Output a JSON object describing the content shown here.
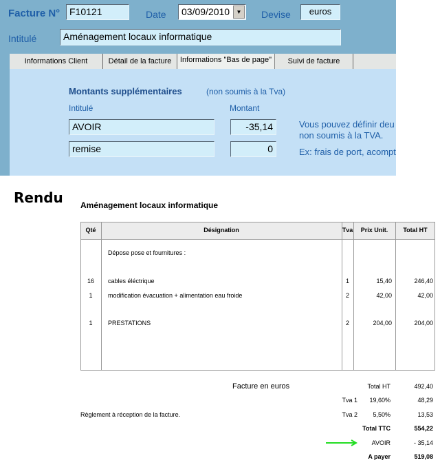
{
  "form": {
    "invoice_label": "Facture N°",
    "invoice_number": "F10121",
    "date_label": "Date",
    "date_value": "03/09/2010",
    "currency_label": "Devise",
    "currency_value": "euros",
    "title_label": "Intitulé",
    "title_value": "Aménagement locaux informatique"
  },
  "tabs": [
    {
      "label": "Informations Client"
    },
    {
      "label": "Détail de la facture"
    },
    {
      "label": "Informations \"Bas de page\"",
      "active": true
    },
    {
      "label": "Suivi de facture"
    },
    {
      "label": ""
    }
  ],
  "extra": {
    "heading": "Montants supplémentaires",
    "subheading": "(non soumis à la Tva)",
    "col_label": "Intitulé",
    "col_amount": "Montant",
    "rows": [
      {
        "label": "AVOIR",
        "amount": "-35,14"
      },
      {
        "label": "remise",
        "amount": "0"
      }
    ],
    "help_1": "Vous pouvez définir deu",
    "help_2": "non soumis à la TVA.",
    "help_3": "Ex: frais de port, acompt"
  },
  "render": {
    "heading": "Rendu",
    "title": "Aménagement locaux informatique",
    "columns": [
      "Qté",
      "Désignation",
      "Tva",
      "Prix Unit.",
      "Total HT"
    ],
    "lines": [
      {
        "qty": "",
        "designation": "Dépose pose et fournitures :",
        "tva": "",
        "price": "",
        "total": ""
      },
      {
        "qty": "16",
        "designation": "cables éléctrique",
        "tva": "1",
        "price": "15,40",
        "total": "246,40"
      },
      {
        "qty": "1",
        "designation": "modification évacuation + alimentation eau froide",
        "tva": "2",
        "price": "42,00",
        "total": "42,00"
      },
      {
        "qty": "1",
        "designation": "PRESTATIONS",
        "tva": "2",
        "price": "204,00",
        "total": "204,00"
      }
    ],
    "currency_note": "Facture en  euros",
    "payment_note": "Règlement à réception de la facture.",
    "totals": [
      {
        "label": "Total HT",
        "value": "492,40",
        "bold": false
      },
      {
        "label": "Tva 1",
        "rate": "19,60%",
        "value": "48,29"
      },
      {
        "label": "Tva 2",
        "rate": "5,50%",
        "value": "13,53"
      },
      {
        "label": "Total TTC",
        "value": "554,22",
        "bold": true
      },
      {
        "label": "AVOIR",
        "value": "- 35,14"
      },
      {
        "label": "A payer",
        "value": "519,08",
        "bold": true
      }
    ],
    "arrow_color": "#22dd22"
  }
}
